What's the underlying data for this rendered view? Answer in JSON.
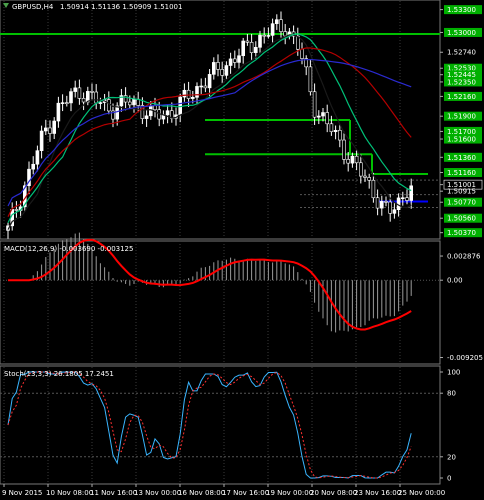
{
  "header": {
    "symbol_text": "GBPUSD,H4",
    "ohlc_text": "1.50914 1.51136 1.50909 1.51001"
  },
  "price_panel": {
    "axis_labels": [
      "1.53300",
      "1.53000",
      "1.52740",
      "1.52530",
      "1.52445",
      "1.52350",
      "1.52160",
      "1.51900",
      "1.51700",
      "1.51600",
      "1.51360",
      "1.51160",
      "1.51001",
      "1.50915",
      "1.50770",
      "1.50560",
      "1.50370"
    ],
    "highlight_labels": [
      "1.53300",
      "1.53000",
      "1.52745",
      "1.52530",
      "1.52445",
      "1.52350",
      "1.52160",
      "1.51900",
      "1.51700",
      "1.51600",
      "1.51360",
      "1.51160",
      "1.50770",
      "1.50560",
      "1.50370"
    ],
    "current_price_label": "1.51001",
    "green_levels": [
      1.5298,
      1.5185,
      1.514,
      1.5114
    ],
    "blue_level": 1.5078
  },
  "macd_panel": {
    "title": "MACD(12,26,9) -0.003690 -0.003125",
    "axis_labels": [
      "0.002876",
      "0.00",
      "-0.009205"
    ]
  },
  "stoch_panel": {
    "title": "Stoch(13,3,3) 26.1805 17.2451",
    "axis_labels": [
      "100",
      "80",
      "20",
      "0"
    ]
  },
  "time_axis": {
    "labels": [
      "9 Nov 2015",
      "10 Nov 08:00",
      "11 Nov 16:00",
      "13 Nov 00:00",
      "16 Nov 08:00",
      "17 Nov 16:00",
      "19 Nov 00:00",
      "20 Nov 08:00",
      "23 Nov 16:00",
      "25 Nov 00:00"
    ]
  },
  "colors": {
    "background": "#000000",
    "grid": "#3a3a3a",
    "bull_candle": "#ffffff",
    "bear_candle": "#000000",
    "candle_wick": "#ffffff",
    "level_line": "#00c000",
    "blue_level": "#0000ff",
    "ma_fast": "#00c078",
    "ma_mid": "#b40000",
    "ma_slow": "#2a2ad0",
    "ma_black": "#1a1a1a",
    "macd_signal": "#ff0000",
    "macd_hist": "#9a9a9a",
    "stoch_main": "#3ab5ff",
    "stoch_signal": "#ff3030",
    "label_bg_green": "#00b000"
  }
}
